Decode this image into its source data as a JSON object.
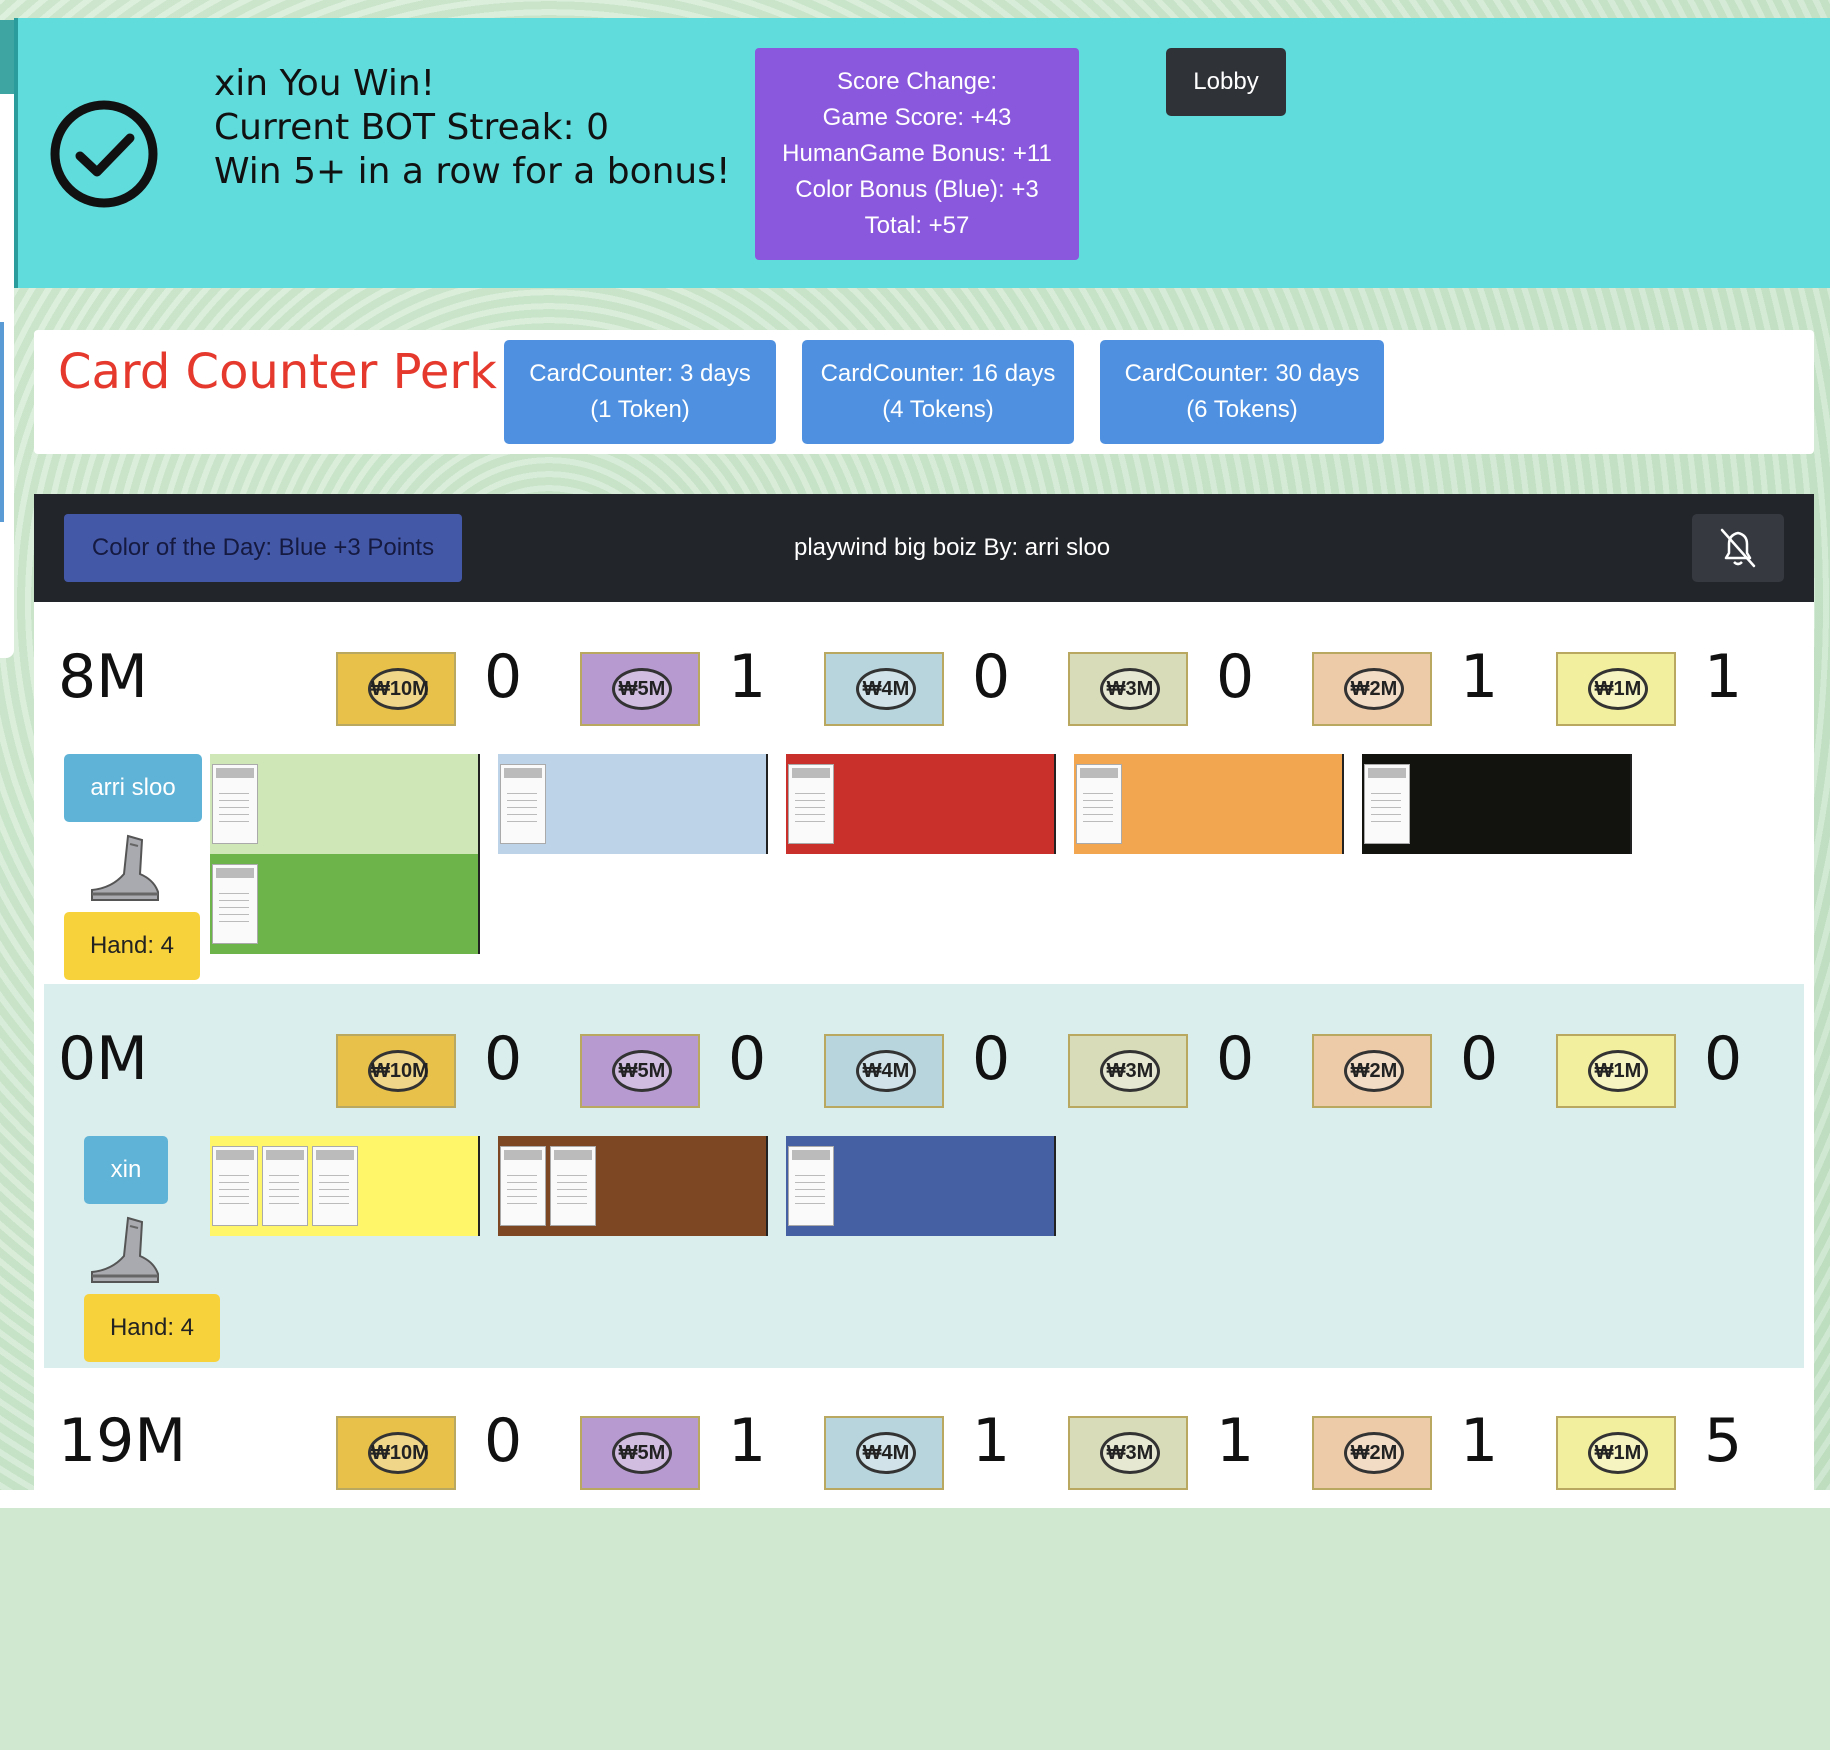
{
  "win_banner": {
    "line1": "xin You Win!",
    "line2": "Current BOT Streak: 0",
    "line3": "Win 5+ in a row for a bonus!",
    "score_change": {
      "title": "Score Change:",
      "game_score": "Game Score: +43",
      "human_bonus": "HumanGame Bonus: +11",
      "color_bonus": "Color Bonus (Blue): +3",
      "total": "Total: +57"
    },
    "lobby_label": "Lobby"
  },
  "perk": {
    "title": "Card Counter Perk",
    "options": [
      {
        "line1": "CardCounter: 3 days",
        "line2": "(1 Token)"
      },
      {
        "line1": "CardCounter: 16 days",
        "line2": "(4 Tokens)"
      },
      {
        "line1": "CardCounter: 30 days",
        "line2": "(6 Tokens)"
      }
    ]
  },
  "game": {
    "color_of_day": "Color of the Day: Blue +3 Points",
    "title": "playwind big boiz By: arri sloo",
    "bell_icon": "bell-slash-icon"
  },
  "bill_labels": [
    "₩10M",
    "₩5M",
    "₩4M",
    "₩3M",
    "₩2M",
    "₩1M"
  ],
  "bill_colors": [
    "#e8c14a",
    "#b79ad0",
    "#b8d4dc",
    "#d9dcb8",
    "#edcaa8",
    "#f2ef9e"
  ],
  "players": [
    {
      "money": "8M",
      "counts": [
        "0",
        "1",
        "0",
        "0",
        "1",
        "1"
      ],
      "name": "arri sloo",
      "hand": "Hand: 4",
      "active": false,
      "properties": [
        "#cfe7b6/#6db54a",
        "#bcd3e8",
        "#c9302c",
        "#f2a650",
        "#12120e"
      ]
    },
    {
      "money": "0M",
      "counts": [
        "0",
        "0",
        "0",
        "0",
        "0",
        "0"
      ],
      "name": "xin",
      "hand": "Hand: 4",
      "active": true,
      "properties": [
        "#fff66a",
        "#7e4724",
        "#4561a3"
      ]
    },
    {
      "money": "19M",
      "counts": [
        "0",
        "1",
        "1",
        "1",
        "1",
        "5"
      ]
    }
  ]
}
